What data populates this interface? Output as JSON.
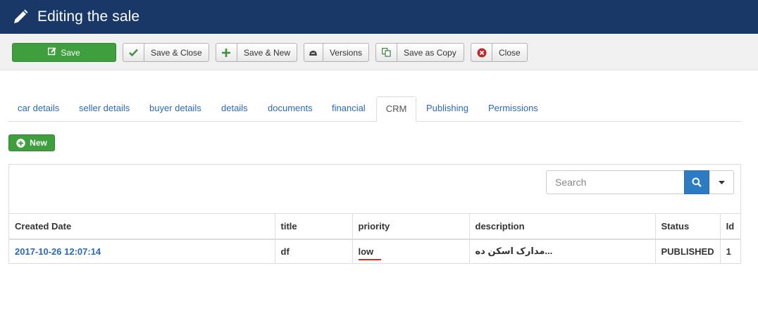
{
  "header": {
    "title": "Editing the sale",
    "icon": "pencil-icon"
  },
  "toolbar": {
    "save": "Save",
    "save_close": "Save & Close",
    "save_new": "Save & New",
    "versions": "Versions",
    "save_copy": "Save as Copy",
    "close": "Close"
  },
  "tabs": [
    {
      "label": "car details"
    },
    {
      "label": "seller details"
    },
    {
      "label": "buyer details"
    },
    {
      "label": "details"
    },
    {
      "label": "documents"
    },
    {
      "label": "financial"
    },
    {
      "label": "CRM"
    },
    {
      "label": "Publishing"
    },
    {
      "label": "Permissions"
    }
  ],
  "active_tab": "CRM",
  "new_button": "New",
  "search": {
    "placeholder": "Search",
    "value": ""
  },
  "table": {
    "columns": [
      "Created Date",
      "title",
      "priority",
      "description",
      "Status",
      "Id"
    ],
    "rows": [
      {
        "created": "2017-10-26 12:07:14",
        "title": "df",
        "priority": "low",
        "description": "مدارک اسکن ده...",
        "status": "PUBLISHED",
        "id": "1"
      }
    ]
  },
  "colors": {
    "header": "#1a3867",
    "save": "#3f9f3f",
    "link": "#2a69b8",
    "search_button": "#2d7bc3",
    "underline": "#e0242a"
  }
}
